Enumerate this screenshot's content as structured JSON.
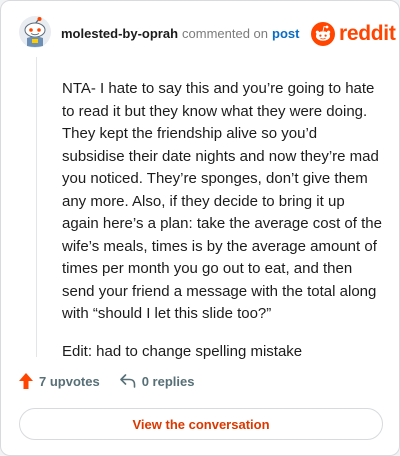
{
  "comment": {
    "username": "molested-by-oprah",
    "action_text": "commented on",
    "post_link_label": "post",
    "paragraphs": [
      "NTA- I hate to say this and you’re going to hate to read it but they know what they were doing. They kept the friendship alive so you’d subsidise their date nights and now they’re mad you noticed. They’re sponges, don’t give them any more. Also, if they decide to bring it up again here’s a plan: take the average cost of the wife’s meals, times is by the average amount of times per month you go out to eat, and then send your friend a message with the total along with “should I let this slide too?”",
      "Edit: had to change spelling mistake"
    ]
  },
  "brand": {
    "name": "reddit",
    "icon": "reddit-logo-icon",
    "color": "#ff4500"
  },
  "footer": {
    "upvotes_label": "7 upvotes",
    "upvote_icon": "upvote-arrow-icon",
    "upvote_color": "#ff4500",
    "replies_label": "0 replies",
    "reply_icon": "reply-arrow-icon"
  },
  "actions": {
    "view_conversation_label": "View the conversation",
    "accent_color": "#d93900"
  },
  "avatar": {
    "icon": "snoo-avatar-icon"
  }
}
